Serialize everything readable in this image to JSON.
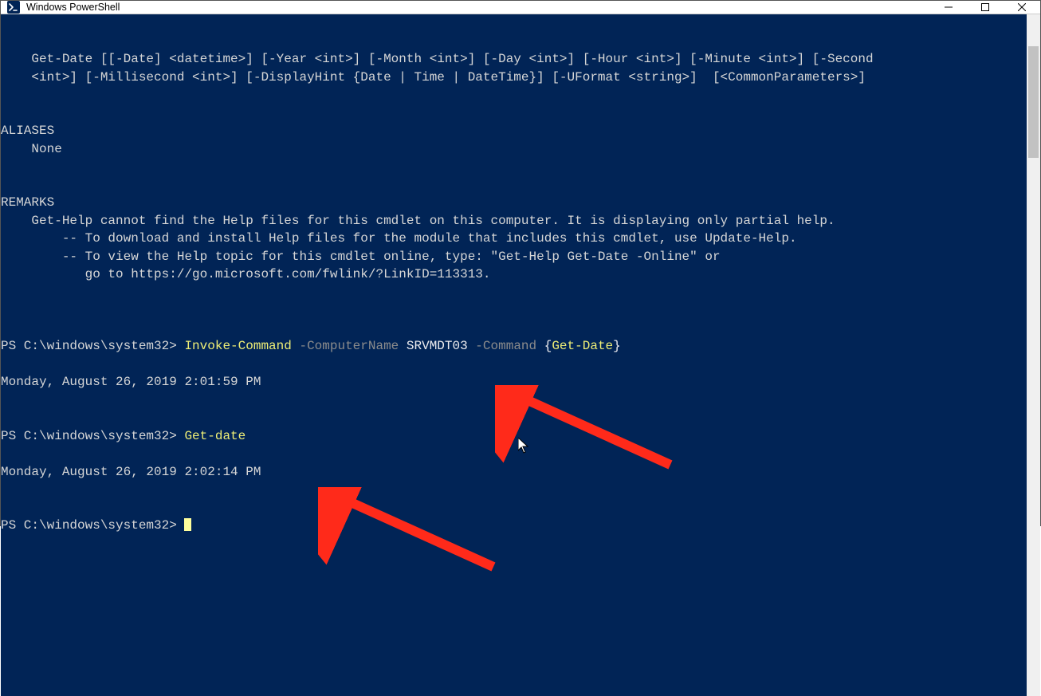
{
  "window": {
    "title": "Windows PowerShell"
  },
  "colors": {
    "terminal_bg": "#012456",
    "text": "#d6d6d6",
    "yellow": "#eeee76",
    "gray": "#8c8c8c",
    "arrow": "#ff2a1a"
  },
  "help_syntax": {
    "line1": "    Get-Date [[-Date] <datetime>] [-Year <int>] [-Month <int>] [-Day <int>] [-Hour <int>] [-Minute <int>] [-Second",
    "line2": "    <int>] [-Millisecond <int>] [-DisplayHint {Date | Time | DateTime}] [-UFormat <string>]  [<CommonParameters>]"
  },
  "aliases": {
    "header": "ALIASES",
    "body": "    None"
  },
  "remarks": {
    "header": "REMARKS",
    "line1": "    Get-Help cannot find the Help files for this cmdlet on this computer. It is displaying only partial help.",
    "line2": "        -- To download and install Help files for the module that includes this cmdlet, use Update-Help.",
    "line3": "        -- To view the Help topic for this cmdlet online, type: \"Get-Help Get-Date -Online\" or",
    "line4": "           go to https://go.microsoft.com/fwlink/?LinkID=113313."
  },
  "prompt": "PS C:\\windows\\system32> ",
  "cmd1": {
    "invoke": "Invoke-Command",
    "p_computer": " -ComputerName ",
    "computer": "SRVMDT03",
    "p_command": " -Command ",
    "brace_open": "{",
    "getdate": "Get-Date",
    "brace_close": "}"
  },
  "out1": "Monday, August 26, 2019 2:01:59 PM",
  "cmd2": {
    "getdate": "Get-date"
  },
  "out2": "Monday, August 26, 2019 2:02:14 PM"
}
